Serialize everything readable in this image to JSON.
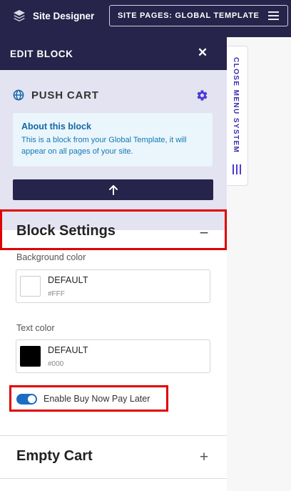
{
  "topbar": {
    "brand_label": "Site Designer",
    "site_pages_label": "SITE PAGES: GLOBAL TEMPLATE",
    "brand_icon": "layers-icon",
    "menu_icon": "hamburger-icon"
  },
  "panel": {
    "title": "EDIT BLOCK",
    "close_symbol": "✕",
    "block": {
      "name": "PUSH CART",
      "icon": "globe-icon",
      "settings_icon": "gear-icon"
    },
    "about": {
      "title": "About this block",
      "text": "This is a block from your Global Template, it will appear on all pages of your site."
    },
    "move_up_icon": "arrow-up-icon"
  },
  "block_settings": {
    "title": "Block Settings",
    "collapse_symbol": "−",
    "background_color": {
      "label": "Background color",
      "name": "DEFAULT",
      "value": "#FFF",
      "swatch": "#ffffff"
    },
    "text_color": {
      "label": "Text color",
      "name": "DEFAULT",
      "value": "#000",
      "swatch": "#000000"
    },
    "bnpl_toggle": {
      "label": "Enable Buy Now Pay Later",
      "enabled": true
    }
  },
  "empty_cart": {
    "title": "Empty Cart",
    "expand_symbol": "+"
  },
  "side_tab": {
    "label": "CLOSE MENU SYSTEM",
    "icon": "menu-bars-icon"
  },
  "colors": {
    "primary_dark": "#26244a",
    "accent_purple": "#4b3ad6",
    "info_blue": "#1466a8",
    "toggle_blue": "#1c6cc4",
    "highlight_red": "#e00000"
  }
}
